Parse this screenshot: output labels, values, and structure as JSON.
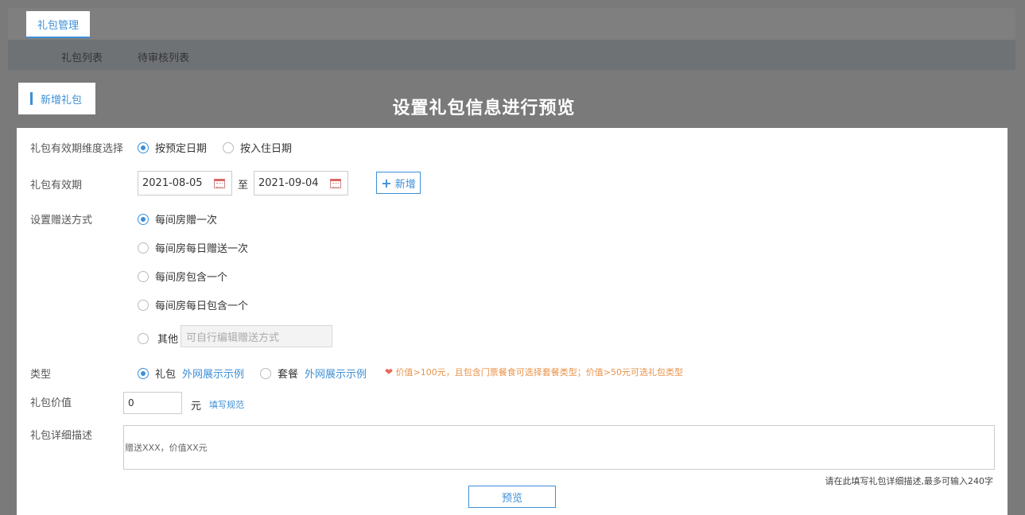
{
  "header": {
    "main_tab": "礼包管理",
    "sub_tabs": [
      "礼包列表",
      "待审核列表"
    ]
  },
  "add_badge": "新增礼包",
  "overlay_title": "设置礼包信息进行预览",
  "form": {
    "validity_dimension": {
      "label": "礼包有效期维度选择",
      "options": [
        "按预定日期",
        "按入住日期"
      ],
      "selected": "按预定日期"
    },
    "validity_period": {
      "label": "礼包有效期",
      "start": "2021-08-05",
      "to": "至",
      "end": "2021-09-04",
      "add_label": "新增"
    },
    "gift_method": {
      "label": "设置赠送方式",
      "options": [
        "每间房赠一次",
        "每间房每日赠送一次",
        "每间房包含一个",
        "每间房每日包含一个",
        "其他"
      ],
      "selected": "每间房赠一次",
      "other_placeholder": "可自行编辑赠送方式"
    },
    "type": {
      "label": "类型",
      "options": [
        "礼包",
        "套餐"
      ],
      "selected": "礼包",
      "example_link": "外网展示示例",
      "hint": "价值>100元，且包含门票餐食可选择套餐类型；价值>50元可选礼包类型"
    },
    "value": {
      "label": "礼包价值",
      "value": "0",
      "unit": "元",
      "rule_link": "填写规范"
    },
    "description": {
      "label": "礼包详细描述",
      "text": "赠送XXX，价值XX元",
      "hint": "请在此填写礼包详细描述,最多可输入240字"
    },
    "preview_label": "预览"
  },
  "colors": {
    "accent": "#3d8fd8",
    "hint": "#e8934a",
    "overlay": "#7a7a7a"
  }
}
